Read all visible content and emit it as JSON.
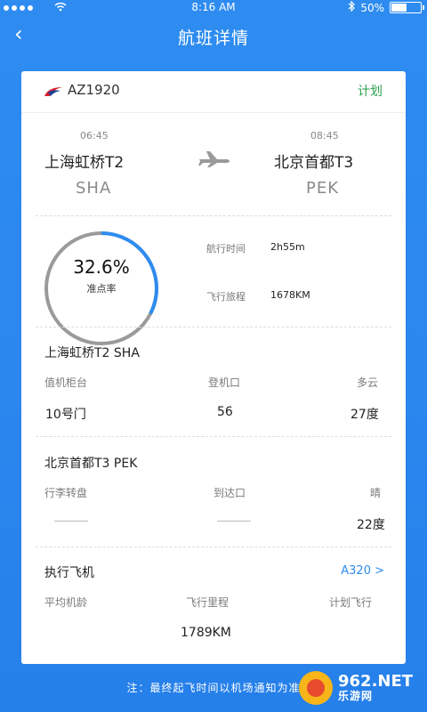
{
  "status_bar": {
    "time": "8:16 AM",
    "battery": "50%",
    "battery_level": 0.5
  },
  "nav": {
    "back_icon": "‹",
    "title": "航班详情"
  },
  "flight": {
    "airline_logo": "china-eastern-logo",
    "number": "AZ1920",
    "status": "计划",
    "departure": {
      "time": "06:45",
      "airport": "上海虹桥T2",
      "code": "SHA"
    },
    "arrival": {
      "time": "08:45",
      "airport": "北京首都T3",
      "code": "PEK"
    }
  },
  "on_time": {
    "value": "32.6%",
    "label": "准点率",
    "fraction": 0.326
  },
  "stats": {
    "duration_label": "航行时间",
    "duration_value": "2h55m",
    "distance_label": "飞行旅程",
    "distance_value": "1678KM"
  },
  "departure_info": {
    "title": "上海虹桥T2 SHA",
    "col1_label": "值机柜台",
    "col2_label": "登机口",
    "col3_label": "多云",
    "col1_value": "10号门",
    "col2_value": "56",
    "col3_value": "27度"
  },
  "arrival_info": {
    "title": "北京首都T3 PEK",
    "col1_label": "行李转盘",
    "col2_label": "到达口",
    "col3_label": "晴",
    "col3_value": "22度"
  },
  "aircraft": {
    "title": "执行飞机",
    "model": "A320 >",
    "col1_label": "平均机龄",
    "col2_label": "飞行里程",
    "col3_label": "计划飞行",
    "col2_value": "1789KM"
  },
  "footnote": "注：最终起飞时间以机场通知为准",
  "watermark": {
    "top": "962.NET",
    "bottom": "乐游网"
  },
  "colors": {
    "accent": "#2e8cf0",
    "status_green": "#2aa24f",
    "ring_track": "#9a9a9a"
  }
}
